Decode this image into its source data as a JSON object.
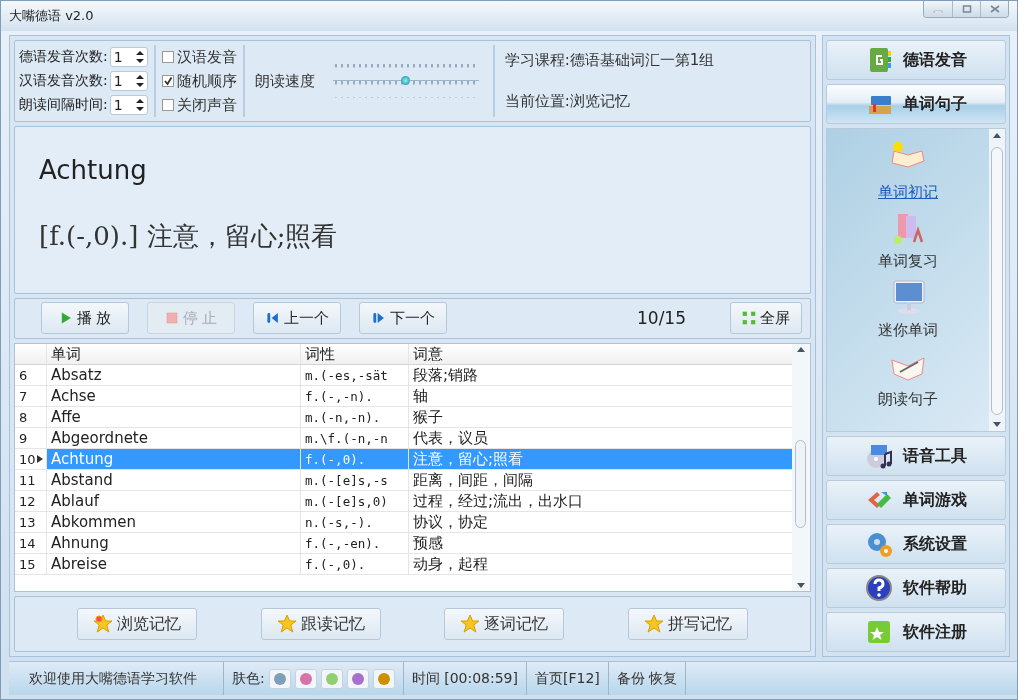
{
  "window": {
    "title": "大嘴德语 v2.0"
  },
  "settings": {
    "spinners": [
      {
        "label": "德语发音次数:",
        "value": "1"
      },
      {
        "label": "汉语发音次数:",
        "value": "1"
      },
      {
        "label": "朗读间隔时间:",
        "value": "1"
      }
    ],
    "checkboxes": [
      {
        "label": "汉语发音",
        "checked": false
      },
      {
        "label": "随机顺序",
        "checked": true
      },
      {
        "label": "关闭声音",
        "checked": false
      }
    ],
    "speed": {
      "label": "朗读速度",
      "level": 0.5
    },
    "course": "学习课程:德语基础词汇一第1组",
    "position": "当前位置:浏览记忆"
  },
  "display": {
    "word": "Achtung",
    "definition": "[f.(-,0).] 注意，留心;照看"
  },
  "toolbar": {
    "buttons": [
      {
        "label": "播 放",
        "kind": "play",
        "disabled": false
      },
      {
        "label": "停 止",
        "kind": "stop",
        "disabled": true
      },
      {
        "label": "上一个",
        "kind": "prev",
        "disabled": false
      },
      {
        "label": "下一个",
        "kind": "next",
        "disabled": false
      }
    ],
    "counter": "10/15",
    "fullscreen": "全屏"
  },
  "table": {
    "columns": [
      "单词",
      "词性",
      "词意"
    ],
    "rows": [
      {
        "index": "6",
        "word": "Absatz",
        "pos": "m.(-es,-sät",
        "meaning": "段落;销路",
        "selected": false
      },
      {
        "index": "7",
        "word": "Achse",
        "pos": "f.(-,-n).",
        "meaning": "轴",
        "selected": false
      },
      {
        "index": "8",
        "word": "Affe",
        "pos": "m.(-n,-n).",
        "meaning": "猴子",
        "selected": false
      },
      {
        "index": "9",
        "word": "Abgeordnete",
        "pos": "m.\\f.(-n,-n",
        "meaning": "代表，议员",
        "selected": false
      },
      {
        "index": "10",
        "word": "Achtung",
        "pos": "f.(-,0).",
        "meaning": "注意，留心;照看",
        "selected": true
      },
      {
        "index": "11",
        "word": "Abstand",
        "pos": "m.(-[e]s,-s",
        "meaning": "距离，间距，间隔",
        "selected": false
      },
      {
        "index": "12",
        "word": "Ablauf",
        "pos": "m.(-[e]s,0)",
        "meaning": "过程，经过;流出，出水口",
        "selected": false
      },
      {
        "index": "13",
        "word": "Abkommen",
        "pos": "n.(-s,-).",
        "meaning": "协议，协定",
        "selected": false
      },
      {
        "index": "14",
        "word": "Ahnung",
        "pos": "f.(-,-en).",
        "meaning": "预感",
        "selected": false
      },
      {
        "index": "15",
        "word": "Abreise",
        "pos": "f.(-,0).",
        "meaning": "动身，起程",
        "selected": false
      }
    ]
  },
  "modes": [
    {
      "label": "浏览记忆",
      "selected": true
    },
    {
      "label": "跟读记忆",
      "selected": false
    },
    {
      "label": "逐词记忆",
      "selected": false
    },
    {
      "label": "拼写记忆",
      "selected": false
    }
  ],
  "sidebar": {
    "sections": [
      {
        "label": "德语发音",
        "expanded": false
      },
      {
        "label": "单词句子",
        "expanded": true,
        "items": [
          {
            "label": "单词初记",
            "selected": true
          },
          {
            "label": "单词复习",
            "selected": false
          },
          {
            "label": "迷你单词",
            "selected": false
          },
          {
            "label": "朗读句子",
            "selected": false
          }
        ]
      },
      {
        "label": "语音工具",
        "expanded": false
      },
      {
        "label": "单词游戏",
        "expanded": false
      },
      {
        "label": "系统设置",
        "expanded": false
      },
      {
        "label": "软件帮助",
        "expanded": false
      },
      {
        "label": "软件注册",
        "expanded": false
      }
    ]
  },
  "status_bar": {
    "welcome": "欢迎使用大嘴德语学习软件",
    "skin_label": "肤色:",
    "skins": [
      {
        "color": "#7f9fb8"
      },
      {
        "color": "#d673a8"
      },
      {
        "color": "#8fcf6f"
      },
      {
        "color": "#a86fcf"
      },
      {
        "color": "#cf9000"
      }
    ],
    "time": "时间 [00:08:59]",
    "home": "首页[F12]",
    "backup": "备份",
    "restore": "恢复"
  }
}
